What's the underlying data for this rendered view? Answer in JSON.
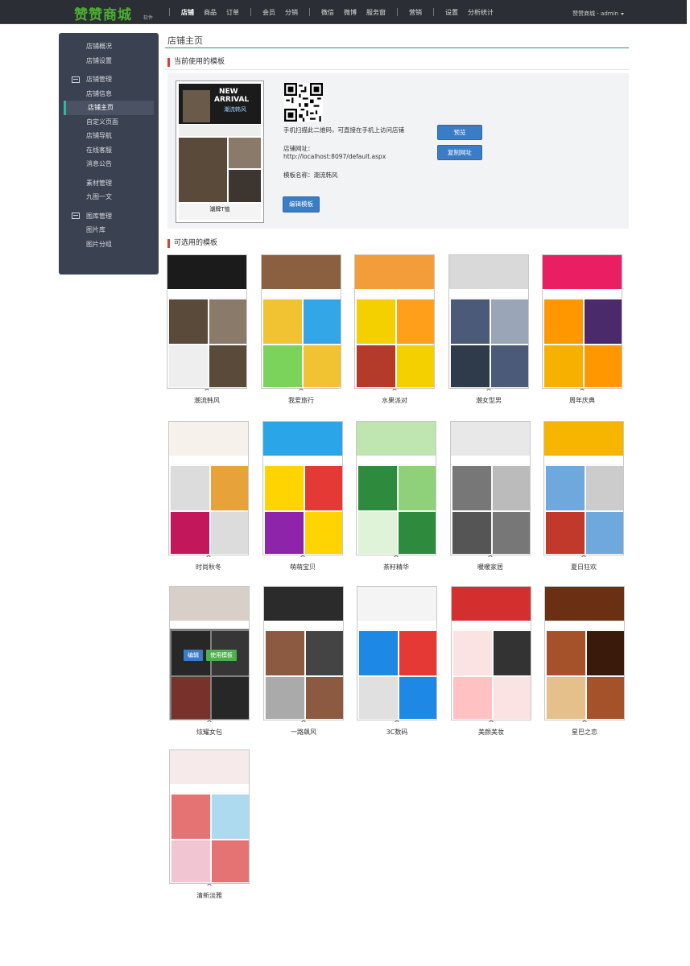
{
  "brand": {
    "logo": "赞赞商城",
    "sub": "软件"
  },
  "nav": {
    "items": [
      "店铺",
      "商品",
      "订单",
      "会员",
      "分销",
      "微信",
      "微博",
      "服务窗",
      "营销",
      "设置",
      "分析统计"
    ],
    "active": "店铺"
  },
  "user": {
    "label": "赞赞商城 - admin"
  },
  "sidebar": {
    "top_links": [
      "店铺概况",
      "店铺设置"
    ],
    "group1": {
      "title": "店铺管理",
      "links": [
        "店铺信息",
        "店铺主页",
        "自定义页面",
        "店铺导航",
        "在线客服",
        "消息公告"
      ]
    },
    "mid_links": [
      "素材管理",
      "九图一文"
    ],
    "group2": {
      "title": "图库管理",
      "links": [
        "图片库",
        "图片分组"
      ]
    },
    "active": "店铺主页"
  },
  "page": {
    "title": "店铺主页"
  },
  "current": {
    "section_title": "当前使用的模板",
    "qr_hint": "手机扫描此二维码，可直接在手机上访问店铺",
    "url_label": "店铺网址：",
    "url": "http://localhost:8097/default.aspx",
    "template_name_label": "模板名称：",
    "template_name": "潮流韩风",
    "edit_button": "编辑模板",
    "preview_button": "预览",
    "copy_button": "复制网址",
    "thumb_text": {
      "headline1": "NEW",
      "headline2": "ARRIVAL",
      "tag": "潮流韩风",
      "footer": "潮牌T恤"
    }
  },
  "available": {
    "section_title": "可选用的模板",
    "templates": [
      {
        "name": "潮流韩风",
        "chevron": "^"
      },
      {
        "name": "我爱旅行",
        "chevron": "^"
      },
      {
        "name": "水果派对",
        "chevron": "^"
      },
      {
        "name": "潮女型男",
        "chevron": "^"
      },
      {
        "name": "周年庆典",
        "chevron": "^"
      },
      {
        "name": "时尚秋冬",
        "chevron": "^"
      },
      {
        "name": "萌萌宝贝",
        "chevron": "^"
      },
      {
        "name": "茶籽精华",
        "chevron": "^"
      },
      {
        "name": "暖暖家居",
        "chevron": "^"
      },
      {
        "name": "夏日狂欢",
        "chevron": "^"
      },
      {
        "name": "炫耀女包",
        "chevron": "^"
      },
      {
        "name": "一路飙风",
        "chevron": "^"
      },
      {
        "name": "3C数码",
        "chevron": "^"
      },
      {
        "name": "美颜美妆",
        "chevron": "^"
      },
      {
        "name": "星巴之恋",
        "chevron": "^"
      },
      {
        "name": "清新淡雅",
        "chevron": "^"
      }
    ],
    "hover_buttons": {
      "edit": "编辑",
      "use": "使用模板"
    }
  },
  "colors": {
    "topbar": "#2b2f35",
    "sidebar": "#3a4150",
    "accent": "#1a9c74",
    "button": "#3b7dc4",
    "section_marker": "#e53935"
  }
}
